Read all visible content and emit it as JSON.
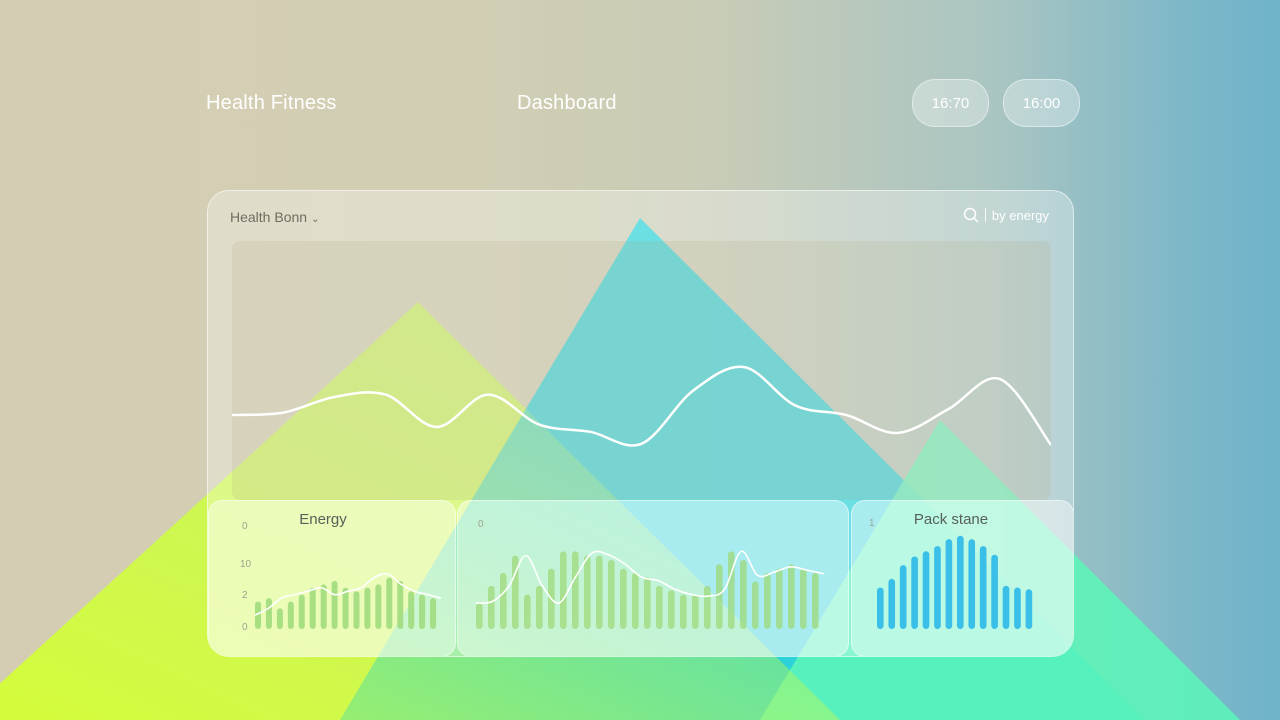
{
  "header": {
    "app_title": "Health Fitness",
    "page_title": "Dashboard",
    "time_pills": [
      "16:70",
      "16:00"
    ]
  },
  "panel": {
    "title": "Health Bonn",
    "search_label": "by energy"
  },
  "cards": [
    {
      "title": "Energy",
      "y_labels": [
        "0",
        "10",
        "2",
        "0"
      ]
    },
    {
      "title": "",
      "y_labels": [
        "0"
      ]
    },
    {
      "title": "Pack stane",
      "y_labels": [
        "1"
      ]
    }
  ],
  "colors": {
    "lime": "#c8f75a",
    "cyan": "#22d6dc",
    "mint": "#5cf5b8",
    "bar_green": "#9ed97a",
    "bar_blue": "#2bb8e8",
    "line": "#ffffff"
  },
  "chart_data": [
    {
      "type": "line",
      "x": [
        0,
        1,
        2,
        3,
        4,
        5,
        6,
        7,
        8,
        9,
        10,
        11,
        12,
        13,
        14,
        15,
        16
      ],
      "series": [
        {
          "values": [
            0.3,
            0.32,
            0.45,
            0.47,
            0.2,
            0.47,
            0.22,
            0.16,
            0.06,
            0.5,
            0.7,
            0.38,
            0.3,
            0.15,
            0.35,
            0.6,
            0.05
          ]
        }
      ]
    },
    {
      "type": "bar",
      "values": [
        4,
        4.5,
        3,
        4,
        5,
        6,
        6.5,
        7,
        6,
        5.5,
        6,
        6.5,
        7.5,
        7,
        5.5,
        5,
        4.5
      ],
      "series": [
        {
          "values": [
            2,
            3,
            4.5,
            5,
            5.5,
            6,
            5,
            5.5,
            6,
            7.5,
            8,
            6.5,
            5.5,
            5,
            4.5
          ]
        }
      ]
    },
    {
      "type": "bar",
      "values": [
        3,
        5,
        6.5,
        8.5,
        4,
        5,
        7,
        9,
        9,
        8.5,
        8.5,
        8,
        7,
        6.5,
        6,
        5,
        4.5,
        4,
        4,
        5,
        7.5,
        9,
        8,
        5.5,
        6.5,
        7,
        7.5,
        7,
        6.5
      ],
      "series": [
        {
          "values": [
            3,
            3.2,
            5,
            8.5,
            5,
            3,
            6,
            8.8,
            8.6,
            7.5,
            6,
            5.6,
            4.6,
            4,
            3.8,
            4.6,
            9,
            6.2,
            6.6,
            7.2,
            6.8,
            6.4
          ]
        }
      ]
    },
    {
      "type": "bar",
      "values": [
        4.8,
        5.8,
        7.4,
        8.4,
        9.0,
        9.6,
        10.4,
        10.8,
        10.4,
        9.6,
        8.6,
        5.0,
        4.8,
        4.6
      ]
    }
  ]
}
